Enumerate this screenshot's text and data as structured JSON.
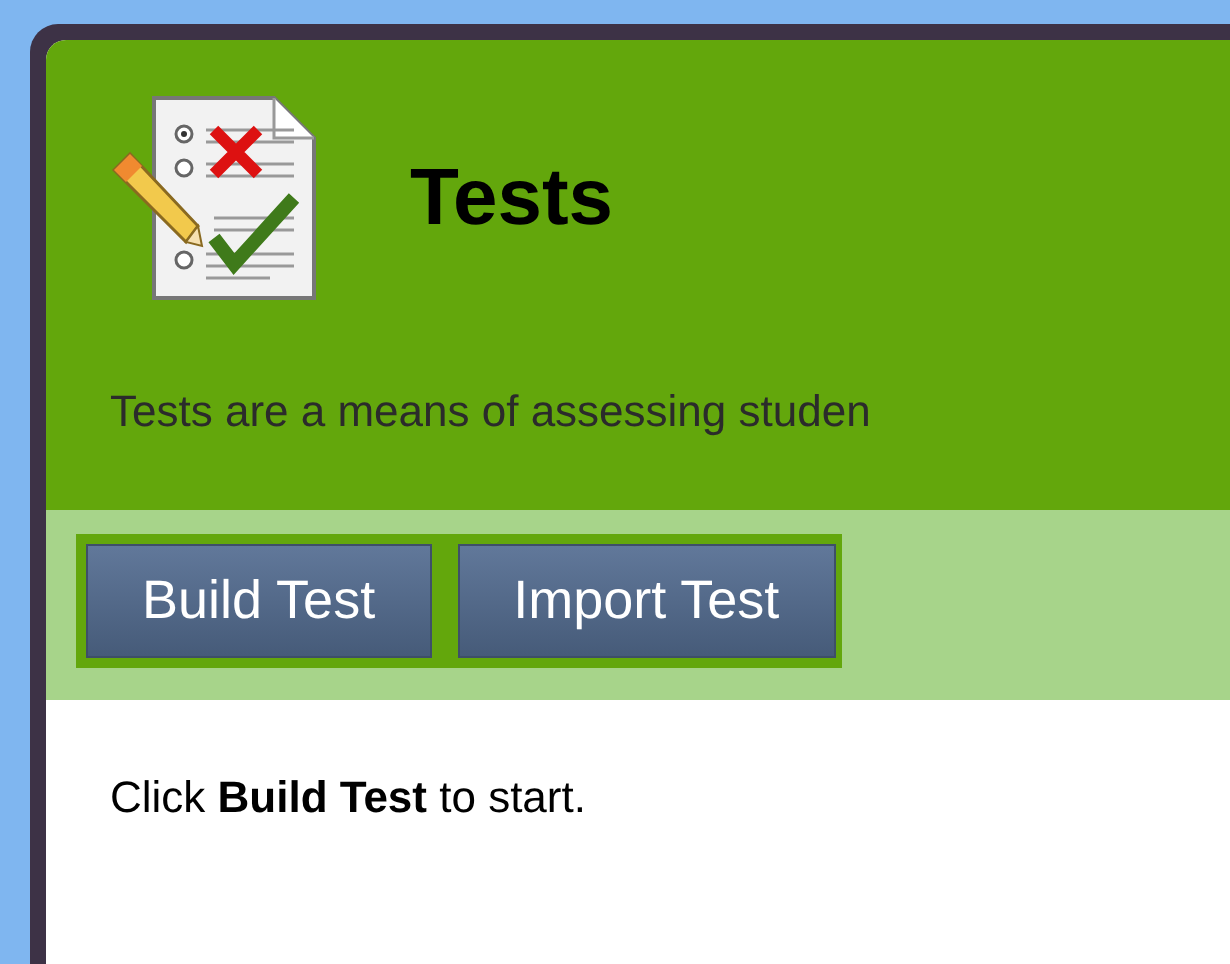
{
  "header": {
    "title": "Tests",
    "description": "Tests are a means of assessing studen"
  },
  "toolbar": {
    "buttons": [
      "Build Test",
      "Import Test"
    ]
  },
  "content": {
    "instruction": "Click **Build Test** to start."
  }
}
